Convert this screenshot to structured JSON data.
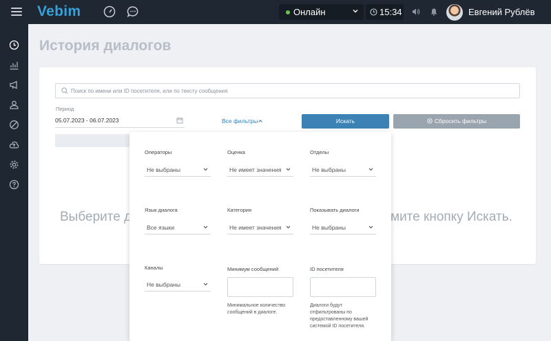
{
  "topbar": {
    "logo": "Vebim",
    "status": "Онлайн",
    "status_color": "#6cc04a",
    "time": "15:34",
    "user_name": "Евгений Рублёв",
    "icons": [
      "menu-icon",
      "dashboard-gauge-icon",
      "chat-bubble-icon",
      "clock-icon",
      "volume-icon",
      "bell-icon"
    ]
  },
  "sidebar": {
    "items": [
      "history-icon",
      "stats-chart-icon",
      "megaphone-icon",
      "users-icon",
      "ban-icon",
      "cloud-upload-icon",
      "settings-gear-icon",
      "help-icon"
    ]
  },
  "page": {
    "title": "История диалогов",
    "search_placeholder": "Поиск по имени или ID посетителя, или по тексту сообщения",
    "period_label": "Период",
    "period_value": "05.07.2023 - 06.07.2023",
    "all_filters": "Все фильтры",
    "search_button": "Искать",
    "reset_button": "Сбросить фильтры",
    "hint_left": "Выберите ди",
    "hint_right": "мите кнопку Искать."
  },
  "filters": {
    "operators": {
      "label": "Операторы",
      "value": "Не выбраны"
    },
    "rating": {
      "label": "Оценка",
      "value": "Не имеет значения"
    },
    "departments": {
      "label": "Отделы",
      "value": "Не выбраны"
    },
    "language": {
      "label": "Язык диалога",
      "value": "Все языки"
    },
    "category": {
      "label": "Категория",
      "value": "Не имеет значения"
    },
    "show_dialogs": {
      "label": "Показывать диалоги",
      "value": "Не выбраны"
    },
    "channels": {
      "label": "Каналы",
      "value": "Не выбраны"
    },
    "min_messages": {
      "label": "Минимум сообщений",
      "value": "",
      "help": "Минимальное количество сообщений в диалоге."
    },
    "visitor_id": {
      "label": "ID посетителя",
      "value": "",
      "help": "Диалоги будут отфильтрованы по предоставленному вашей системой ID посетителя."
    }
  },
  "colors": {
    "topbar_bg": "#1f2732",
    "accent": "#3d82b5",
    "reset_bg": "#9aa4af",
    "link": "#2d7fc1"
  }
}
